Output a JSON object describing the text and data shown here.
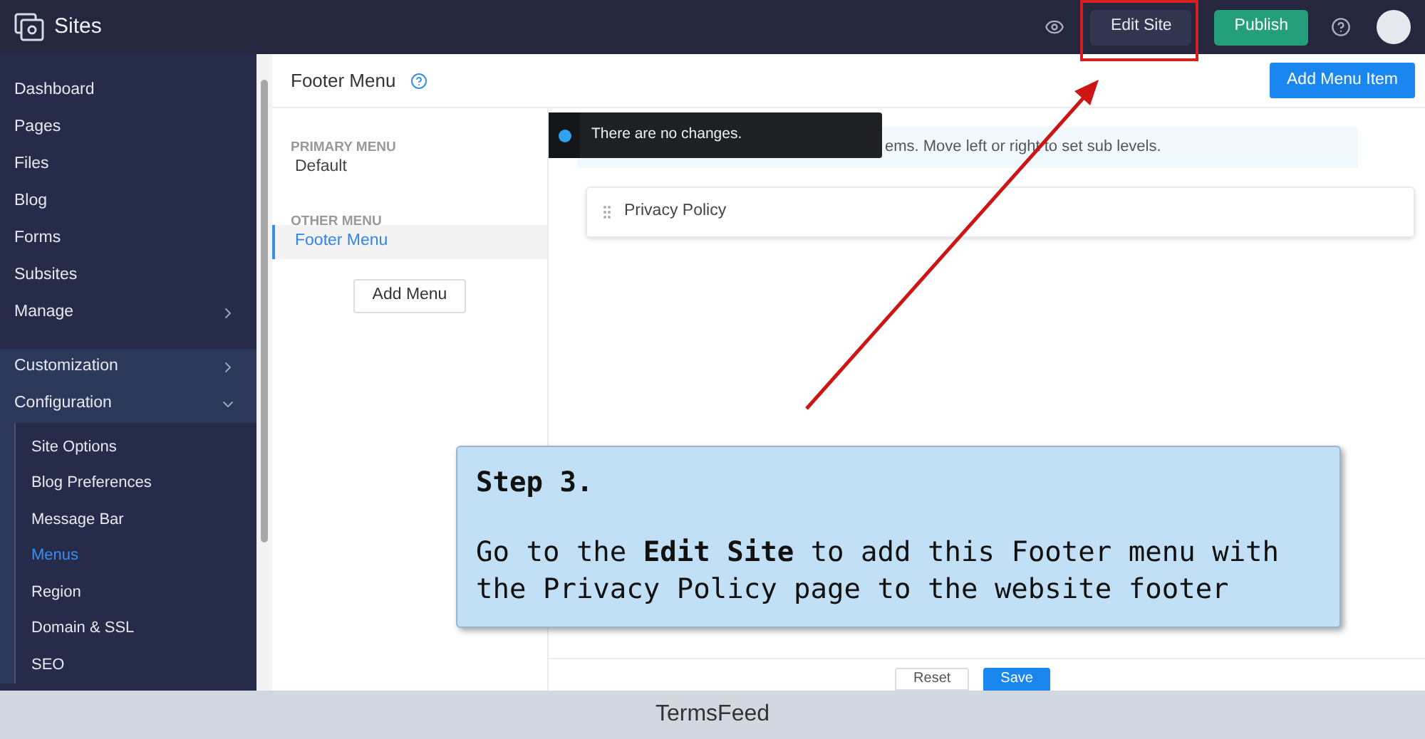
{
  "app": {
    "title": "Sites"
  },
  "header_buttons": [
    {
      "label": "Edit Site",
      "kind": "secondary"
    },
    {
      "label": "Publish",
      "kind": "primary"
    }
  ],
  "sidebar": {
    "items": [
      {
        "label": "Dashboard",
        "selected": false
      },
      {
        "label": "Pages",
        "selected": false
      },
      {
        "label": "Files",
        "selected": false
      },
      {
        "label": "Blog",
        "selected": false
      },
      {
        "label": "Forms",
        "selected": false
      },
      {
        "label": "Subsites",
        "selected": false
      },
      {
        "label": "Manage",
        "selected": false,
        "expanded": false
      },
      {
        "label": "Customization",
        "selected": false,
        "expanded": false
      },
      {
        "label": "Configuration",
        "selected": false,
        "expanded": true,
        "children": [
          {
            "label": "Site Options",
            "selected": false
          },
          {
            "label": "Blog Preferences",
            "selected": false
          },
          {
            "label": "Message Bar",
            "selected": false
          },
          {
            "label": "Menus",
            "selected": true
          },
          {
            "label": "Region",
            "selected": false
          },
          {
            "label": "Domain & SSL",
            "selected": false
          },
          {
            "label": "SEO",
            "selected": false
          }
        ]
      }
    ]
  },
  "page": {
    "title": "Footer Menu",
    "add_button": "Add Menu Item"
  },
  "menu_groups": [
    {
      "heading": "PRIMARY MENU",
      "items": [
        {
          "label": "Default",
          "selected": false
        }
      ]
    },
    {
      "heading": "OTHER MENU",
      "items": [
        {
          "label": "Footer Menu",
          "selected": true
        }
      ]
    }
  ],
  "add_menu_button": "Add Menu",
  "toast": {
    "message": "There are no changes."
  },
  "info_banner": "ems. Move left or right to set sub levels.",
  "menu_items": [
    {
      "label": "Privacy Policy"
    }
  ],
  "footer_buttons": [
    {
      "label": "Reset",
      "kind": "secondary"
    },
    {
      "label": "Save",
      "kind": "primary"
    }
  ],
  "callout": {
    "title": "Step 3.",
    "body": "Go to the **Edit Site** to add this Footer menu with the Privacy Policy page to the website footer"
  },
  "caption": "TermsFeed"
}
